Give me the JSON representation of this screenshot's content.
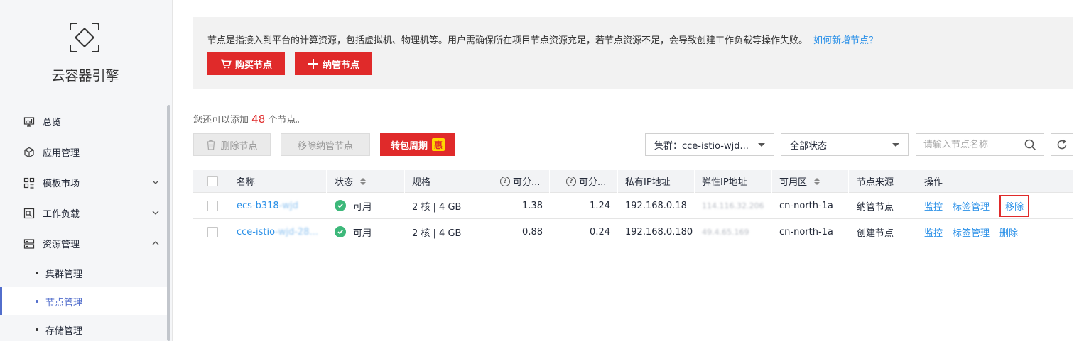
{
  "sidebar": {
    "brand": "云容器引擎",
    "nav": [
      {
        "label": "总览",
        "icon": "monitor-icon"
      },
      {
        "label": "应用管理",
        "icon": "cube-icon"
      },
      {
        "label": "模板市场",
        "icon": "grid-icon",
        "chevron": "down"
      },
      {
        "label": "工作负载",
        "icon": "workload-icon",
        "chevron": "down"
      },
      {
        "label": "资源管理",
        "icon": "server-icon",
        "chevron": "up"
      }
    ],
    "sub": [
      {
        "label": "集群管理",
        "active": false
      },
      {
        "label": "节点管理",
        "active": true
      },
      {
        "label": "存储管理",
        "active": false
      }
    ]
  },
  "info": {
    "text": "节点是指接入到平台的计算资源，包括虚拟机、物理机等。用户需确保所在项目节点资源充足，若节点资源不足，会导致创建工作负载等操作失败。",
    "link": "如何新增节点？",
    "buy_label": "购买节点",
    "manage_label": "纳管节点"
  },
  "quota": {
    "prefix": "您还可以添加",
    "count": "48",
    "suffix": "个节点。"
  },
  "toolbar": {
    "delete_label": "删除节点",
    "remove_managed_label": "移除纳管节点",
    "renew_label": "转包周期",
    "renew_badge": "惠",
    "cluster_select": "集群：cce-istio-wjd...",
    "status_select": "全部状态",
    "search_placeholder": "请输入节点名称"
  },
  "table": {
    "headers": {
      "name": "名称",
      "status": "状态",
      "spec": "规格",
      "alloc_cpu": "可分...",
      "alloc_mem": "可分...",
      "private_ip": "私有IP地址",
      "eip": "弹性IP地址",
      "az": "可用区",
      "source": "节点来源",
      "ops": "操作"
    },
    "rows": [
      {
        "name_visible": "ecs-b318",
        "name_masked": "-wjd",
        "status": "可用",
        "spec": "2 核 | 4 GB",
        "alloc_cpu": "1.38",
        "alloc_mem": "1.24",
        "private_ip": "192.168.0.18",
        "eip": "114.116.32.206",
        "az": "cn-north-1a",
        "source": "纳管节点",
        "op1": "监控",
        "op2": "标签管理",
        "op3": "移除"
      },
      {
        "name_visible": "cce-istio",
        "name_masked": "-wjd-28...",
        "status": "可用",
        "spec": "2 核 | 4 GB",
        "alloc_cpu": "0.88",
        "alloc_mem": "0.24",
        "private_ip": "192.168.0.180",
        "eip": "49.4.65.169",
        "az": "cn-north-1a",
        "source": "创建节点",
        "op1": "监控",
        "op2": "标签管理",
        "op3": "删除"
      }
    ]
  },
  "colors": {
    "accent_red": "#e02a2a",
    "link_blue": "#2c91e8",
    "ok_green": "#3db87a",
    "active_nav": "#526ecc"
  }
}
